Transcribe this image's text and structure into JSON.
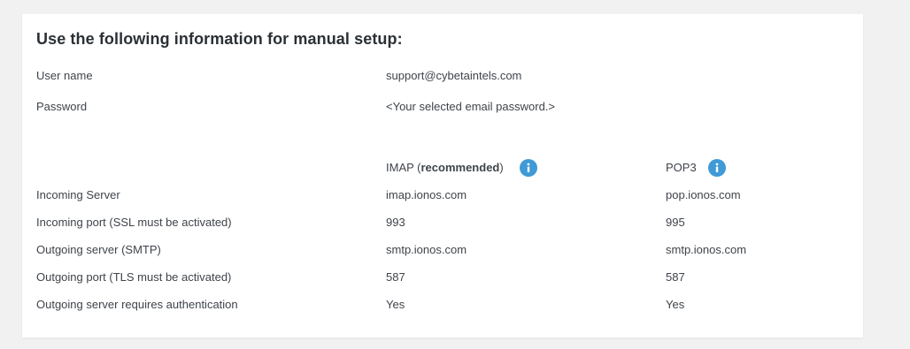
{
  "title": "Use the following information for manual setup:",
  "credentials": {
    "user_name_label": "User name",
    "user_name_value": "support@cybetaintels.com",
    "password_label": "Password",
    "password_value": "<Your selected email password.>"
  },
  "columns": {
    "imap_prefix": "IMAP (",
    "imap_bold": "recommended",
    "imap_suffix": ")",
    "pop3": "POP3",
    "icon": "info-icon",
    "icon_color": "#3f9ad6"
  },
  "rows": [
    {
      "label": "Incoming Server",
      "imap": "imap.ionos.com",
      "pop3": "pop.ionos.com"
    },
    {
      "label": "Incoming port (SSL must be activated)",
      "imap": "993",
      "pop3": "995"
    },
    {
      "label": "Outgoing server (SMTP)",
      "imap": "smtp.ionos.com",
      "pop3": "smtp.ionos.com"
    },
    {
      "label": "Outgoing port (TLS must be activated)",
      "imap": "587",
      "pop3": "587"
    },
    {
      "label": "Outgoing server requires authentication",
      "imap": "Yes",
      "pop3": "Yes"
    }
  ]
}
